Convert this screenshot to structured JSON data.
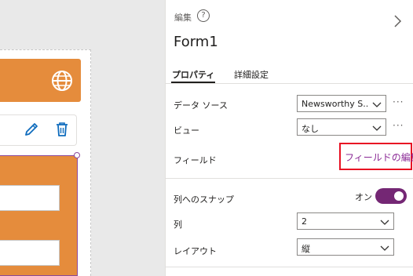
{
  "panel": {
    "breadcrumb": "編集",
    "help_symbol": "?",
    "title": "Form1",
    "tabs": [
      {
        "label": "プロパティ",
        "active": true
      },
      {
        "label": "詳細設定",
        "active": false
      }
    ],
    "datasource": {
      "label": "データ ソース",
      "value": "Newsworthy S..."
    },
    "view": {
      "label": "ビュー",
      "value": "なし"
    },
    "fields": {
      "label": "フィールド",
      "edit_link": "フィールドの編集"
    },
    "snap": {
      "label": "列へのスナップ",
      "state_label": "オン",
      "on": true
    },
    "columns": {
      "label": "列",
      "value": "2"
    },
    "layout": {
      "label": "レイアウト",
      "value": "縦"
    },
    "more_label": "···"
  },
  "colors": {
    "accent": "#742774",
    "link": "#8b2a96",
    "highlight": "#e81123",
    "form_fill": "#e58c3c"
  },
  "icons": [
    "globe-icon",
    "pencil-icon",
    "trash-icon",
    "help-icon",
    "chevron-right-icon",
    "chevron-down-icon"
  ]
}
